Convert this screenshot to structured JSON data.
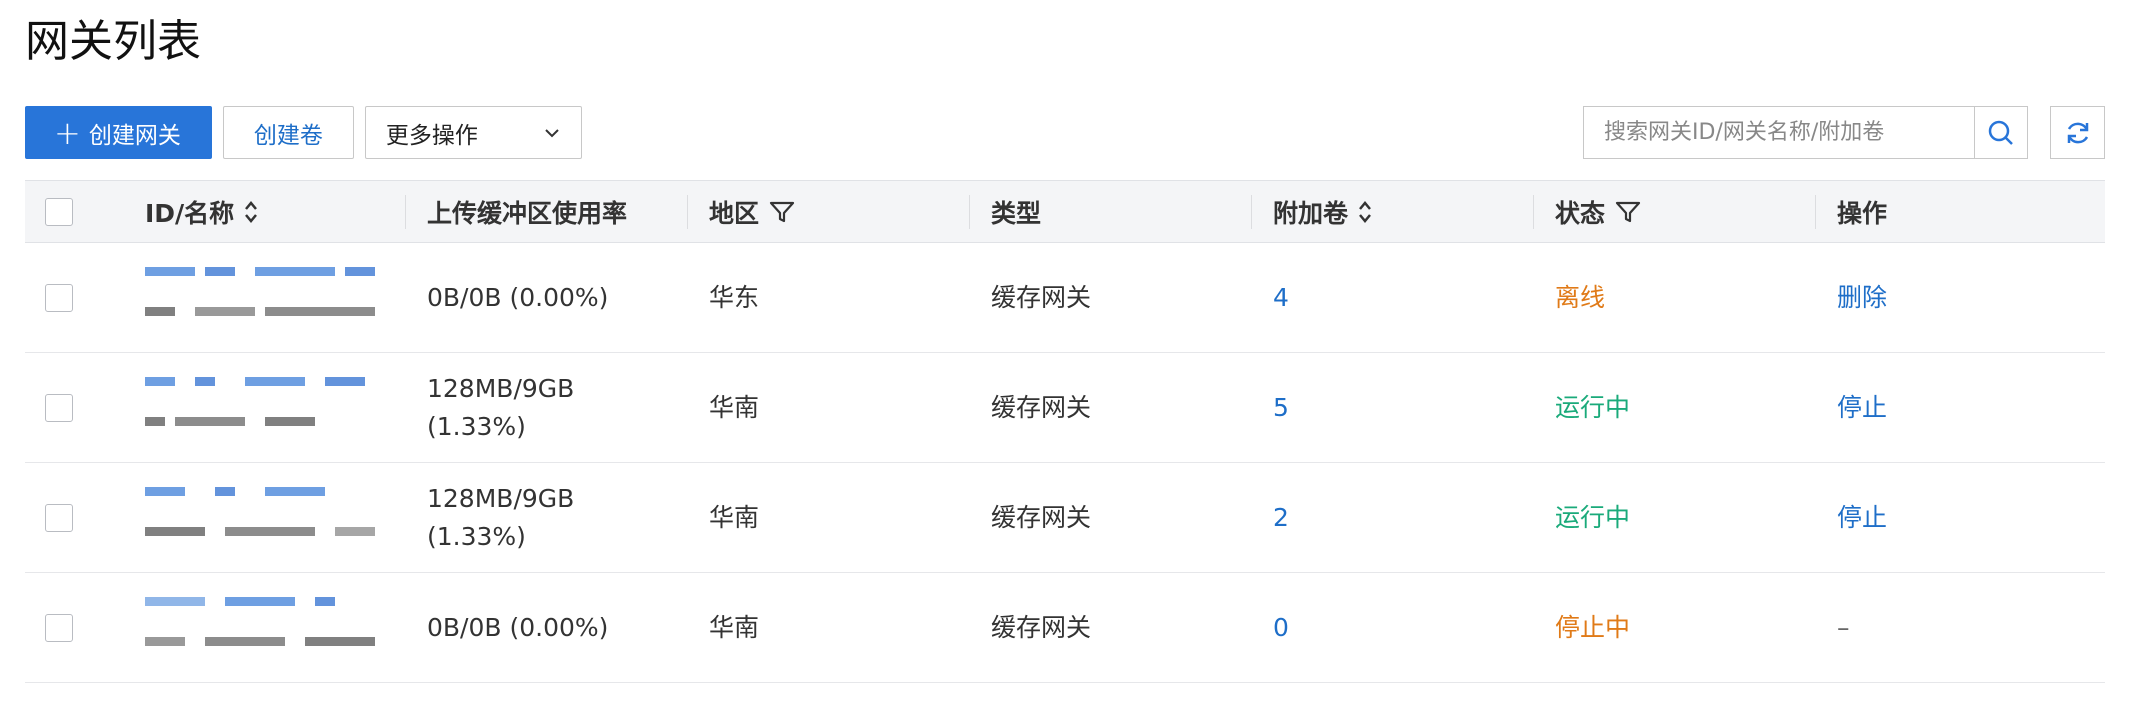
{
  "page": {
    "title": "网关列表"
  },
  "toolbar": {
    "create_gateway_label": "创建网关",
    "create_volume_label": "创建卷",
    "more_actions_label": "更多操作"
  },
  "search": {
    "placeholder": "搜索网关ID/网关名称/附加卷"
  },
  "table": {
    "columns": [
      "ID/名称",
      "上传缓冲区使用率",
      "地区",
      "类型",
      "附加卷",
      "状态",
      "操作"
    ],
    "rows": [
      {
        "usage": "0B/0B (0.00%)",
        "usage_line2": "",
        "region": "华东",
        "type": "缓存网关",
        "volumes": "4",
        "status": "离线",
        "status_kind": "offline",
        "action": "删除"
      },
      {
        "usage": "128MB/9GB",
        "usage_line2": "(1.33%)",
        "region": "华南",
        "type": "缓存网关",
        "volumes": "5",
        "status": "运行中",
        "status_kind": "running",
        "action": "停止"
      },
      {
        "usage": "128MB/9GB",
        "usage_line2": "(1.33%)",
        "region": "华南",
        "type": "缓存网关",
        "volumes": "2",
        "status": "运行中",
        "status_kind": "running",
        "action": "停止"
      },
      {
        "usage": "0B/0B (0.00%)",
        "usage_line2": "",
        "region": "华南",
        "type": "缓存网关",
        "volumes": "0",
        "status": "停止中",
        "status_kind": "stopping",
        "action": "–"
      }
    ]
  },
  "colors": {
    "primary": "#2875d9",
    "link": "#1e6ec8",
    "offline": "#e07a17",
    "running": "#1aaa7a"
  }
}
